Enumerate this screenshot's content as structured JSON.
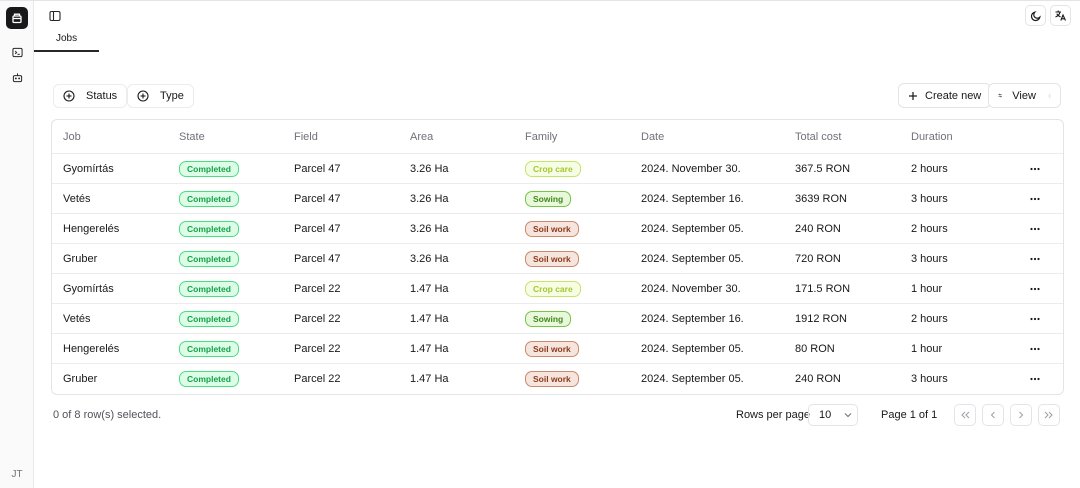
{
  "sidebar": {
    "avatar_initials": "JT"
  },
  "tabs": [
    {
      "label": "Jobs"
    }
  ],
  "filters": {
    "status_label": "Status",
    "type_label": "Type"
  },
  "actions": {
    "create_label": "Create new",
    "view_label": "View"
  },
  "table": {
    "columns": [
      "Job",
      "State",
      "Field",
      "Area",
      "Family",
      "Date",
      "Total cost",
      "Duration"
    ],
    "rows": [
      {
        "job": "Gyomírtás",
        "state": "Completed",
        "field": "Parcel 47",
        "area": "3.26 Ha",
        "family": "Crop care",
        "date": "2024. November 30.",
        "cost": "367.5 RON",
        "duration": "2 hours"
      },
      {
        "job": "Vetés",
        "state": "Completed",
        "field": "Parcel 47",
        "area": "3.26 Ha",
        "family": "Sowing",
        "date": "2024. September 16.",
        "cost": "3639 RON",
        "duration": "3 hours"
      },
      {
        "job": "Hengerelés",
        "state": "Completed",
        "field": "Parcel 47",
        "area": "3.26 Ha",
        "family": "Soil work",
        "date": "2024. September 05.",
        "cost": "240 RON",
        "duration": "2 hours"
      },
      {
        "job": "Gruber",
        "state": "Completed",
        "field": "Parcel 47",
        "area": "3.26 Ha",
        "family": "Soil work",
        "date": "2024. September 05.",
        "cost": "720 RON",
        "duration": "3 hours"
      },
      {
        "job": "Gyomírtás",
        "state": "Completed",
        "field": "Parcel 22",
        "area": "1.47 Ha",
        "family": "Crop care",
        "date": "2024. November 30.",
        "cost": "171.5 RON",
        "duration": "1 hour"
      },
      {
        "job": "Vetés",
        "state": "Completed",
        "field": "Parcel 22",
        "area": "1.47 Ha",
        "family": "Sowing",
        "date": "2024. September 16.",
        "cost": "1912 RON",
        "duration": "2 hours"
      },
      {
        "job": "Hengerelés",
        "state": "Completed",
        "field": "Parcel 22",
        "area": "1.47 Ha",
        "family": "Soil work",
        "date": "2024. September 05.",
        "cost": "80 RON",
        "duration": "1 hour"
      },
      {
        "job": "Gruber",
        "state": "Completed",
        "field": "Parcel 22",
        "area": "1.47 Ha",
        "family": "Soil work",
        "date": "2024. September 05.",
        "cost": "240 RON",
        "duration": "3 hours"
      }
    ]
  },
  "footer": {
    "selection_text": "0 of 8 row(s) selected.",
    "rows_per_page_label": "Rows per page",
    "rows_per_page_value": "10",
    "page_text": "Page 1 of 1"
  },
  "icons": {
    "logo": "box-logo-icon",
    "sidebar_terminal": "terminal-icon",
    "sidebar_bot": "bot-icon",
    "panel_toggle": "panel-left-icon",
    "theme": "moon-icon",
    "language": "languages-icon",
    "row_menu": "more-horizontal-icon"
  }
}
